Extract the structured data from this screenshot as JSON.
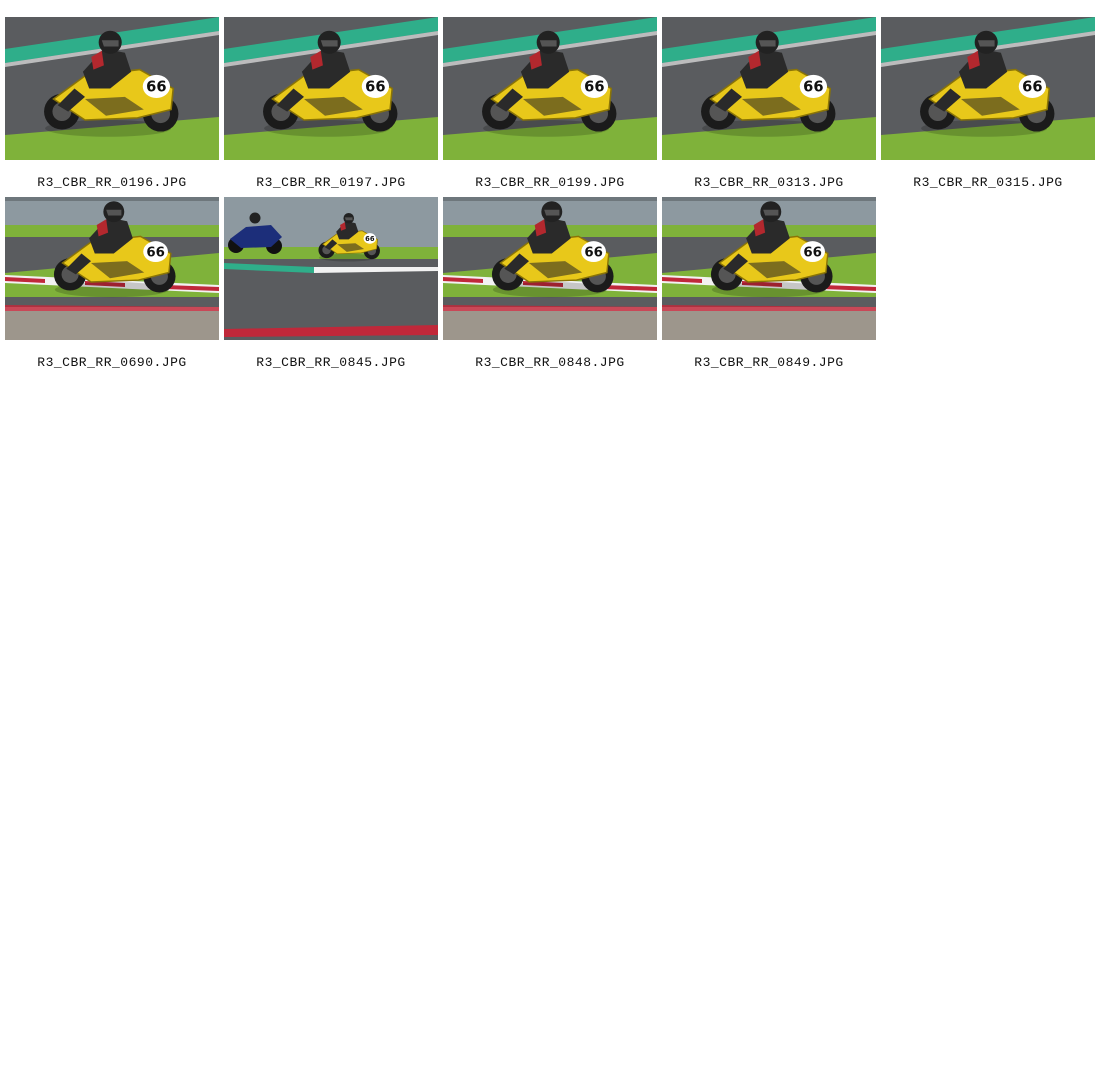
{
  "gallery": {
    "rows": [
      {
        "items": [
          {
            "filename": "R3_CBR_RR_0196.JPG",
            "scene": "track-corner-close",
            "race_number": "66"
          },
          {
            "filename": "R3_CBR_RR_0197.JPG",
            "scene": "track-corner-close",
            "race_number": "66"
          },
          {
            "filename": "R3_CBR_RR_0199.JPG",
            "scene": "track-corner-close",
            "race_number": "66"
          },
          {
            "filename": "R3_CBR_RR_0313.JPG",
            "scene": "track-corner-close",
            "race_number": "66"
          },
          {
            "filename": "R3_CBR_RR_0315.JPG",
            "scene": "track-corner-close",
            "race_number": "66"
          }
        ]
      },
      {
        "items": [
          {
            "filename": "R3_CBR_RR_0690.JPG",
            "scene": "kerb-corner",
            "race_number": "66"
          },
          {
            "filename": "R3_CBR_RR_0845.JPG",
            "scene": "wide-two-bikes",
            "race_number": "66"
          },
          {
            "filename": "R3_CBR_RR_0848.JPG",
            "scene": "kerb-corner",
            "race_number": "66"
          },
          {
            "filename": "R3_CBR_RR_0849.JPG",
            "scene": "kerb-corner",
            "race_number": "66"
          }
        ]
      }
    ]
  },
  "colors": {
    "page_background": "#ffffff",
    "caption_text": "#111111",
    "bike_yellow": "#e8c81a",
    "track_green_band": "#2fae8a",
    "grass": "#7fb23a",
    "asphalt": "#5a5c5f",
    "kerb_red": "#c0283a"
  }
}
